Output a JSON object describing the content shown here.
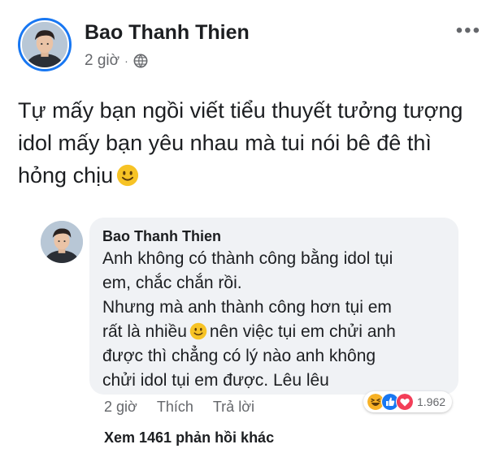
{
  "post": {
    "author": "Bao Thanh Thien",
    "time": "2 giờ",
    "separator": "·",
    "privacy_icon": "globe-icon",
    "more_icon": "more-options-icon",
    "text_lines": [
      "Tự mấy bạn ngồi viết tiểu thuyết tưởng tượng",
      "idol mấy bạn yêu nhau mà tui nói bê đê thì",
      "hỏng chịu"
    ],
    "emoji": "slightly-smiling-face-icon"
  },
  "comment": {
    "author": "Bao Thanh Thien",
    "line1": "Anh không có thành công bằng idol tụi",
    "line2": "em, chắc chắn rồi.",
    "line3": "Nhưng mà anh thành công hơn tụi em",
    "line4a": "rất là nhiều",
    "line4b": "nên việc tụi em chửi anh",
    "line5": "được thì chẳng có lý nào anh không",
    "line6": "chửi idol tụi em được. Lêu lêu",
    "time": "2 giờ",
    "like_label": "Thích",
    "reply_label": "Trả lời",
    "reactions": [
      "haha-icon",
      "like-icon",
      "love-icon"
    ],
    "reaction_count": "1.962",
    "more_replies": "Xem 1461 phản hồi khác"
  },
  "colors": {
    "accent": "#1877f2",
    "bubble": "#f0f2f5",
    "secondary_text": "#65676b",
    "love": "#f33e58",
    "haha": "#f7b125"
  }
}
